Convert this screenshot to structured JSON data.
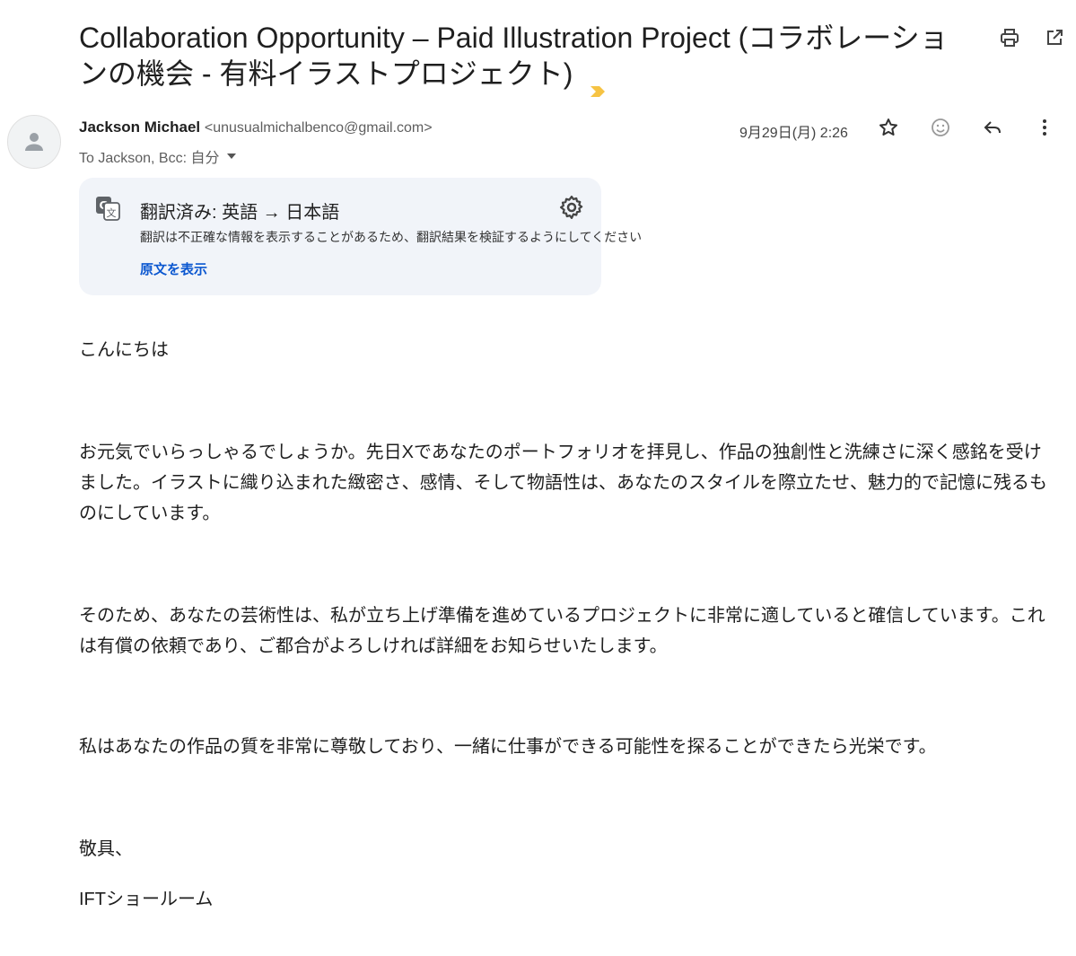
{
  "subject": "Collaboration Opportunity – Paid Illustration Project (コラボレーションの機会 - 有料イラストプロジェクト)",
  "icons": {
    "label": "importance-marker-icon",
    "print": "print-icon",
    "popout": "open-in-new-window-icon",
    "avatar": "person-avatar-icon",
    "recipient_caret": "caret-down-icon",
    "star": "star-icon",
    "emoji": "add-reaction-icon",
    "reply": "reply-icon",
    "more": "more-vert-icon",
    "translate": "google-translate-icon",
    "settings": "gear-icon"
  },
  "colors": {
    "link": "#0b57d0",
    "translate_bg": "#f1f4f9",
    "label_marker": "#f6c343"
  },
  "sender": {
    "name": "Jackson Michael",
    "email": "<unusualmichalbenco@gmail.com>",
    "recipients": "To Jackson, Bcc: 自分",
    "date": "9月29日(月) 2:26"
  },
  "translation": {
    "title": "翻訳済み: 英語 → 日本語",
    "warning": "翻訳は不正確な情報を表示することがあるため、翻訳結果を検証するようにしてください",
    "show_original": "原文を表示"
  },
  "body": {
    "greeting": "こんにちは",
    "p1": "お元気でいらっしゃるでしょうか。先日Xであなたのポートフォリオを拝見し、作品の独創性と洗練さに深く感銘を受けました。イラストに織り込まれた緻密さ、感情、そして物語性は、あなたのスタイルを際立たせ、魅力的で記憶に残るものにしています。",
    "p2": "そのため、あなたの芸術性は、私が立ち上げ準備を進めているプロジェクトに非常に適していると確信しています。これは有償の依頼であり、ご都合がよろしければ詳細をお知らせいたします。",
    "p3": "私はあなたの作品の質を非常に尊敬しており、一緒に仕事ができる可能性を探ることができたら光栄です。",
    "closing": "敬具、",
    "signature": "IFTショールーム"
  }
}
